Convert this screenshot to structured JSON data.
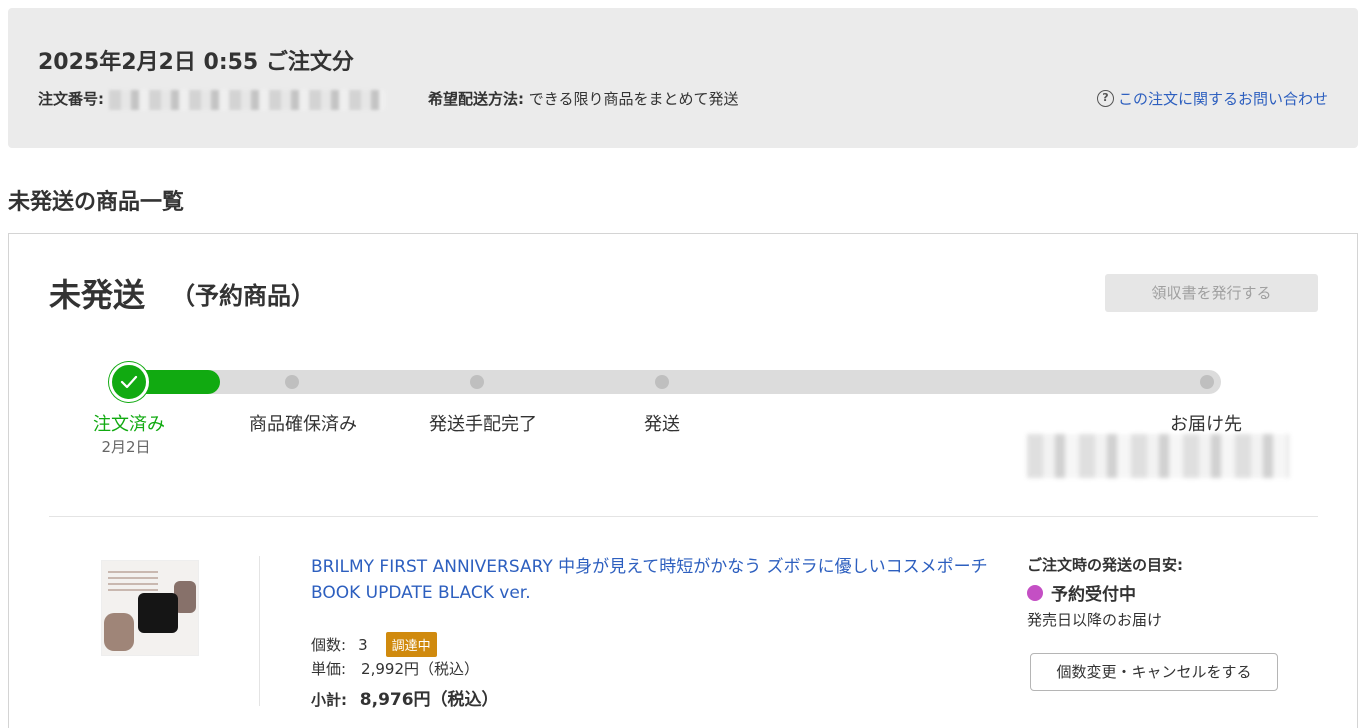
{
  "order": {
    "title": "2025年2月2日 0:55 ご注文分",
    "number_label": "注文番号:",
    "shipping_method_label": "希望配送方法:",
    "shipping_method_value": "できる限り商品をまとめて発送",
    "inquiry_link": "この注文に関するお問い合わせ"
  },
  "section_title": "未発送の商品一覧",
  "status": {
    "title": "未発送",
    "subtitle": "（予約商品）",
    "receipt_button": "領収書を発行する"
  },
  "progress": {
    "completed_fraction": 0.1,
    "steps": [
      {
        "label": "注文済み",
        "date": "2月2日",
        "done": true
      },
      {
        "label": "商品確保済み",
        "done": false
      },
      {
        "label": "発送手配完了",
        "done": false
      },
      {
        "label": "発送",
        "done": false
      },
      {
        "label": "お届け先",
        "done": false
      }
    ]
  },
  "item": {
    "name": "BRILMY FIRST ANNIVERSARY 中身が見えて時短がかなう ズボラに優しいコスメポーチ BOOK UPDATE BLACK ver.",
    "qty_label": "個数:",
    "qty_value": "3",
    "procurement_badge": "調達中",
    "unit_price": "単価:　2,992円（税込）",
    "subtotal_label": "小計:",
    "subtotal_value": "8,976円（税込）"
  },
  "shipping_estimate": {
    "label": "ご注文時の発送の目安:",
    "status": "予約受付中",
    "note": "発売日以降のお届け",
    "change_button": "個数変更・キャンセルをする"
  },
  "colors": {
    "progress_green": "#11aa11",
    "link_blue": "#2d5fbf",
    "badge_orange": "#d08a0e",
    "reserve_purple": "#c44fc4"
  }
}
